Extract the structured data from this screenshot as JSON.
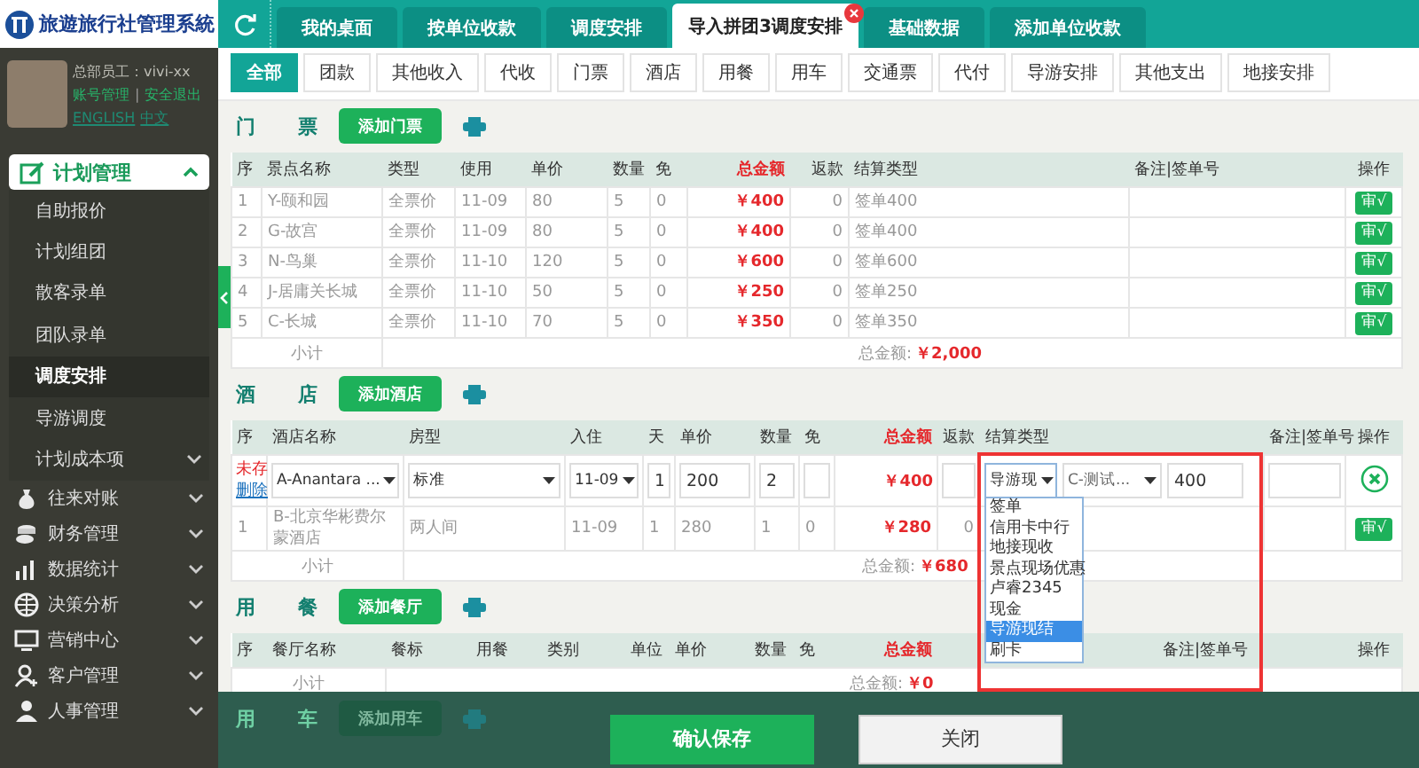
{
  "logo": {
    "title": "旅遊旅行社管理系統"
  },
  "tabs": [
    {
      "label": "我的桌面",
      "selected": false
    },
    {
      "label": "按单位收款",
      "selected": false
    },
    {
      "label": "调度安排",
      "selected": false
    },
    {
      "label": "导入拼团3调度安排",
      "selected": true,
      "closable": true
    },
    {
      "label": "基础数据",
      "selected": false
    },
    {
      "label": "添加单位收款",
      "selected": false
    }
  ],
  "user": {
    "role": "总部员工：vivi-xx",
    "links": [
      "账号管理",
      "安全退出"
    ],
    "separator": "|",
    "languages": [
      "ENGLISH",
      "中文"
    ]
  },
  "menu": [
    {
      "label": "计划管理",
      "expanded": true,
      "children": [
        {
          "label": "自助报价",
          "selected": false
        },
        {
          "label": "计划组团",
          "selected": false
        },
        {
          "label": "散客录单",
          "selected": false
        },
        {
          "label": "团队录单",
          "selected": false
        },
        {
          "label": "调度安排",
          "selected": true
        },
        {
          "label": "导游调度",
          "selected": false
        },
        {
          "label": "计划成本项",
          "selected": false,
          "expanded": false
        }
      ]
    },
    {
      "label": "往来对账",
      "expanded": false
    },
    {
      "label": "财务管理",
      "expanded": false
    },
    {
      "label": "数据统计",
      "expanded": false
    },
    {
      "label": "决策分析",
      "expanded": false
    },
    {
      "label": "营销中心",
      "expanded": false
    },
    {
      "label": "客户管理",
      "expanded": false
    },
    {
      "label": "人事管理",
      "expanded": false
    }
  ],
  "subtabs": [
    {
      "label": "全部",
      "selected": true
    },
    {
      "label": "团款",
      "selected": false
    },
    {
      "label": "其他收入",
      "selected": false
    },
    {
      "label": "代收",
      "selected": false
    },
    {
      "label": "门票",
      "selected": false
    },
    {
      "label": "酒店",
      "selected": false
    },
    {
      "label": "用餐",
      "selected": false
    },
    {
      "label": "用车",
      "selected": false
    },
    {
      "label": "交通票",
      "selected": false
    },
    {
      "label": "代付",
      "selected": false
    },
    {
      "label": "导游安排",
      "selected": false
    },
    {
      "label": "其他支出",
      "selected": false
    },
    {
      "label": "地接安排",
      "selected": false
    }
  ],
  "sections": [
    {
      "kind": "ticket",
      "title": "门 票",
      "add_button": "添加门票",
      "table": {
        "columns": [
          {
            "label": "序",
            "kind": "text"
          },
          {
            "label": "景点名称",
            "kind": "text"
          },
          {
            "label": "类型",
            "kind": "text"
          },
          {
            "label": "使用",
            "kind": "text"
          },
          {
            "label": "单价",
            "kind": "text"
          },
          {
            "label": "数量",
            "kind": "text"
          },
          {
            "label": "免",
            "kind": "text"
          },
          {
            "label": "总金额",
            "kind": "money"
          },
          {
            "label": "返款",
            "kind": "refund"
          },
          {
            "label": "结算类型",
            "kind": "text"
          },
          {
            "label": "备注|签单号",
            "kind": "text"
          },
          {
            "label": "操作",
            "kind": "action"
          }
        ],
        "rows": [
          {
            "kind": "saved",
            "cells": [
              "1",
              "Y-颐和园",
              "全票价",
              "11-09",
              "80",
              "5",
              "0",
              "￥400",
              "0",
              "签单400",
              null,
              null
            ],
            "action": "审√"
          },
          {
            "kind": "saved",
            "cells": [
              "2",
              "G-故宫",
              "全票价",
              "11-09",
              "80",
              "5",
              "0",
              "￥400",
              "0",
              "签单400",
              null,
              null
            ],
            "action": "审√"
          },
          {
            "kind": "saved",
            "cells": [
              "3",
              "N-鸟巢",
              "全票价",
              "11-10",
              "120",
              "5",
              "0",
              "￥600",
              "0",
              "签单600",
              null,
              null
            ],
            "action": "审√"
          },
          {
            "kind": "saved",
            "cells": [
              "4",
              "J-居庸关长城",
              "全票价",
              "11-10",
              "50",
              "5",
              "0",
              "￥250",
              "0",
              "签单250",
              null,
              null
            ],
            "action": "审√"
          },
          {
            "kind": "saved",
            "cells": [
              "5",
              "C-长城",
              "全票价",
              "11-10",
              "70",
              "5",
              "0",
              "￥350",
              "0",
              "签单350",
              null,
              null
            ],
            "action": "审√"
          }
        ],
        "subtotal": {
          "label": "小计",
          "total_label": "总金额:",
          "total": "￥2,000"
        }
      }
    },
    {
      "kind": "hotel",
      "title": "酒 店",
      "add_button": "添加酒店",
      "highlighted": true,
      "table": {
        "columns": [
          {
            "label": "序",
            "kind": "text"
          },
          {
            "label": "酒店名称",
            "kind": "text"
          },
          {
            "label": "房型",
            "kind": "text"
          },
          {
            "label": "入住",
            "kind": "text"
          },
          {
            "label": "天",
            "kind": "text"
          },
          {
            "label": "单价",
            "kind": "text"
          },
          {
            "label": "数量",
            "kind": "text"
          },
          {
            "label": "免",
            "kind": "text"
          },
          {
            "label": "总金额",
            "kind": "money"
          },
          {
            "label": "返款",
            "kind": "refund"
          },
          {
            "label": "结算类型",
            "kind": "text"
          },
          {
            "label": "备注|签单号",
            "kind": "text"
          },
          {
            "label": "操作",
            "kind": "action"
          }
        ],
        "rows": [
          {
            "kind": "edit",
            "cells": [
              {
                "kind": "status",
                "status": "未存",
                "link": "删除"
              },
              {
                "kind": "select",
                "value": "A-Anantara ..."
              },
              {
                "kind": "select",
                "value": "标准"
              },
              {
                "kind": "select",
                "value": "11-09"
              },
              {
                "kind": "input",
                "value": "1"
              },
              {
                "kind": "input",
                "value": "200"
              },
              {
                "kind": "input",
                "value": "2"
              },
              {
                "kind": "input"
              },
              {
                "kind": "money",
                "value": "￥400"
              },
              {
                "kind": "input"
              },
              {
                "kind": "settle",
                "payment": {
                  "value": "导游现",
                  "open": true,
                  "options": [
                    {
                      "label": "签单",
                      "selected": false
                    },
                    {
                      "label": "信用卡中行",
                      "selected": false
                    },
                    {
                      "label": "地接现收",
                      "selected": false
                    },
                    {
                      "label": "景点现场优惠",
                      "selected": false
                    },
                    {
                      "label": "卢睿2345",
                      "selected": false
                    },
                    {
                      "label": "现金",
                      "selected": false
                    },
                    {
                      "label": "导游现结",
                      "selected": true
                    },
                    {
                      "label": "刷卡",
                      "selected": false
                    }
                  ]
                },
                "guide": "C-测试...",
                "amount": "400"
              },
              {
                "kind": "input"
              },
              {
                "kind": "remove"
              }
            ]
          },
          {
            "kind": "saved",
            "cells": [
              "1",
              "B-北京华彬费尔蒙酒店",
              "两人间",
              "11-09",
              "1",
              "280",
              "1",
              "0",
              "￥280",
              "0",
              null,
              null,
              null
            ],
            "action": "审√"
          }
        ],
        "subtotal": {
          "label": "小计",
          "total_label": "总金额:",
          "total": "￥680"
        }
      }
    },
    {
      "kind": "meal",
      "title": "用 餐",
      "add_button": "添加餐厅",
      "table": {
        "columns": [
          {
            "label": "序",
            "kind": "text"
          },
          {
            "label": "餐厅名称",
            "kind": "text"
          },
          {
            "label": "餐标",
            "kind": "text"
          },
          {
            "label": "用餐",
            "kind": "text"
          },
          {
            "label": "类别",
            "kind": "text"
          },
          {
            "label": "单位",
            "kind": "text"
          },
          {
            "label": "单价",
            "kind": "text"
          },
          {
            "label": "数量",
            "kind": "text"
          },
          {
            "label": "免",
            "kind": "text"
          },
          {
            "label": "总金额",
            "kind": "money"
          },
          {
            "kind": "refund"
          },
          {
            "kind": "text"
          },
          {
            "label": "备注|签单号",
            "kind": "text"
          },
          {
            "label": "操作",
            "kind": "action"
          }
        ],
        "subtotal": {
          "label": "小计",
          "total_label": "总金额:",
          "total": "￥0"
        }
      }
    }
  ],
  "footer": {
    "behind": {
      "title": "用 车",
      "add_button": "添加用车"
    },
    "save": "确认保存",
    "close": "关闭"
  }
}
